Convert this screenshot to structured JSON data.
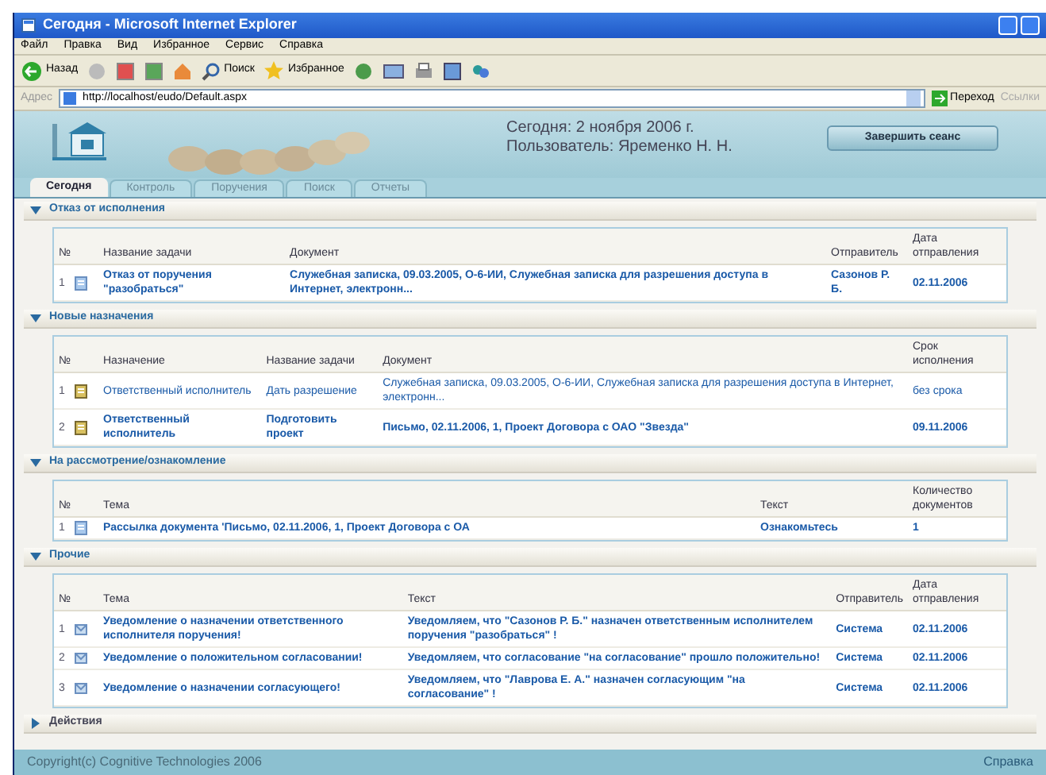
{
  "window": {
    "title": "Сегодня - Microsoft Internet Explorer"
  },
  "menu": [
    "Файл",
    "Правка",
    "Вид",
    "Избранное",
    "Сервис",
    "Справка"
  ],
  "toolbar": {
    "back": "Назад",
    "search": "Поиск",
    "favorites": "Избранное"
  },
  "address": {
    "label": "Адрес",
    "url": "http://localhost/eudo/Default.aspx",
    "go": "Переход",
    "links": "Ссылки"
  },
  "header": {
    "date": "Сегодня: 2 ноября 2006 г.",
    "user": "Пользователь: Яременко Н. Н.",
    "logout": "Завершить сеанс"
  },
  "tabs": [
    {
      "label": "Сегодня",
      "selected": true
    },
    {
      "label": "Контроль",
      "selected": false
    },
    {
      "label": "Поручения",
      "selected": false
    },
    {
      "label": "Поиск",
      "selected": false
    },
    {
      "label": "Отчеты",
      "selected": false
    }
  ],
  "sections": [
    {
      "title": "Отказ от исполнения",
      "expanded": true,
      "columns": [
        "№",
        "Название задачи",
        "Документ",
        "Отправитель",
        "Дата отправления"
      ],
      "rows": [
        {
          "kind": "document",
          "unread": true,
          "cells": [
            "1",
            "Отказ от поручения \"разобраться\"",
            "Служебная записка, 09.03.2005, О-6-ИИ, Служебная записка для разрешения доступа в Интернет, электронн...",
            "Сазонов Р. Б.",
            "02.11.2006"
          ]
        }
      ]
    },
    {
      "title": "Новые назначения",
      "expanded": true,
      "columns": [
        "№",
        "Назначение",
        "Название задачи",
        "Документ",
        "Срок исполнения"
      ],
      "rows": [
        {
          "kind": "notebook",
          "unread": false,
          "cells": [
            "1",
            "Ответственный исполнитель",
            "Дать разрешение",
            "Служебная записка, 09.03.2005, О-6-ИИ, Служебная записка для разрешения доступа в Интернет, электронн...",
            "без срока"
          ]
        },
        {
          "kind": "notebook",
          "unread": true,
          "cells": [
            "2",
            "Ответственный исполнитель",
            "Подготовить проект",
            "Письмо, 02.11.2006, 1, Проект Договора с ОАО \"Звезда\"",
            "09.11.2006"
          ]
        }
      ]
    },
    {
      "title": "На рассмотрение/ознакомление",
      "expanded": true,
      "columns": [
        "№",
        "Тема",
        "Текст",
        "Количество документов"
      ],
      "rows": [
        {
          "kind": "document",
          "unread": true,
          "cells": [
            "1",
            "Рассылка документа 'Письмо, 02.11.2006, 1, Проект Договора с ОА",
            "Ознакомьтесь",
            "1"
          ]
        }
      ]
    },
    {
      "title": "Прочие",
      "expanded": true,
      "columns": [
        "№",
        "Тема",
        "Текст",
        "Отправитель",
        "Дата отправления"
      ],
      "rows": [
        {
          "kind": "message",
          "unread": true,
          "cells": [
            "1",
            "Уведомление о назначении ответственного исполнителя поручения!",
            "Уведомляем, что \"Сазонов Р. Б.\" назначен ответственным исполнителем поручения \"разобраться\" !",
            "Система",
            "02.11.2006"
          ]
        },
        {
          "kind": "message",
          "unread": true,
          "cells": [
            "2",
            "Уведомление о положительном согласовании!",
            "Уведомляем, что согласование \"на согласование\" прошло положительно!",
            "Система",
            "02.11.2006"
          ]
        },
        {
          "kind": "message",
          "unread": true,
          "cells": [
            "3",
            "Уведомление о назначении согласующего!",
            "Уведомляем, что \"Лаврова Е. А.\" назначен согласующим \"на согласование\" !",
            "Система",
            "02.11.2006"
          ]
        }
      ]
    },
    {
      "title": "Действия",
      "expanded": false
    }
  ],
  "footer": {
    "copyright": "Copyright(c) Cognitive Technologies 2006",
    "help": "Справка"
  }
}
